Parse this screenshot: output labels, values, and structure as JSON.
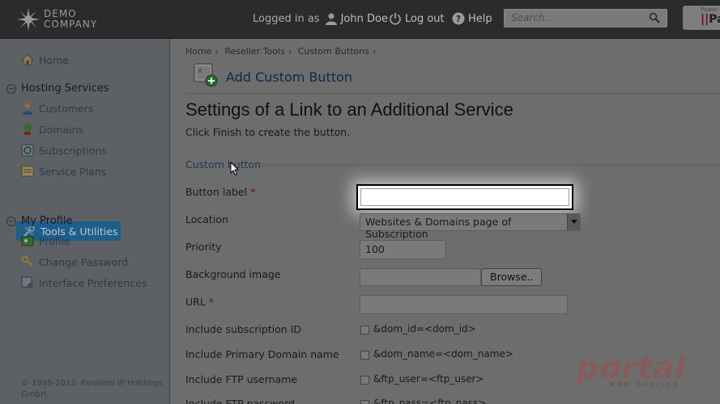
{
  "header": {
    "logo_line1": "DEMO",
    "logo_line2": "COMPANY",
    "logged_in_label": "Logged in as",
    "user_name": "John Doe",
    "logout_label": "Log out",
    "help_label": "Help",
    "search_placeholder": "Search...",
    "powered_label": "Power",
    "powered_brand": "Par"
  },
  "sidebar": {
    "home": "Home",
    "hosting_services": "Hosting Services",
    "customers": "Customers",
    "domains": "Domains",
    "subscriptions": "Subscriptions",
    "service_plans": "Service Plans",
    "tools_utilities": "Tools & Utilities",
    "my_profile": "My Profile",
    "profile": "Profile",
    "change_password": "Change Password",
    "interface_preferences": "Interface Preferences",
    "copyright": "© 1999-2012. Parallels IP Holdings GmbH."
  },
  "breadcrumb": [
    "Home",
    "Reseller Tools",
    "Custom Buttons"
  ],
  "page": {
    "subtitle": "Add Custom Button",
    "title": "Settings of a Link to an Additional Service",
    "description": "Click Finish to create the button.",
    "section": "Custom button"
  },
  "form": {
    "button_label": "Button label",
    "location_label": "Location",
    "location_value": "Websites & Domains page of Subscription",
    "priority_label": "Priority",
    "priority_value": "100",
    "background_label": "Background image",
    "browse": "Browse..",
    "url_label": "URL",
    "include_sub_id": "Include subscription ID",
    "sub_id_param": "&dom_id=<dom_id>",
    "include_primary_domain": "Include Primary Domain name",
    "primary_domain_param": "&dom_name=<dom_name>",
    "include_ftp_user": "Include FTP username",
    "ftp_user_param": "&ftp_user=<ftp_user>",
    "include_ftp_pass": "Include FTP password",
    "ftp_pass_param": "&ftp_pass=<ftp_pass>",
    "required_mark": "*"
  },
  "watermark": {
    "main": "portal",
    "sub": "web hosting"
  }
}
